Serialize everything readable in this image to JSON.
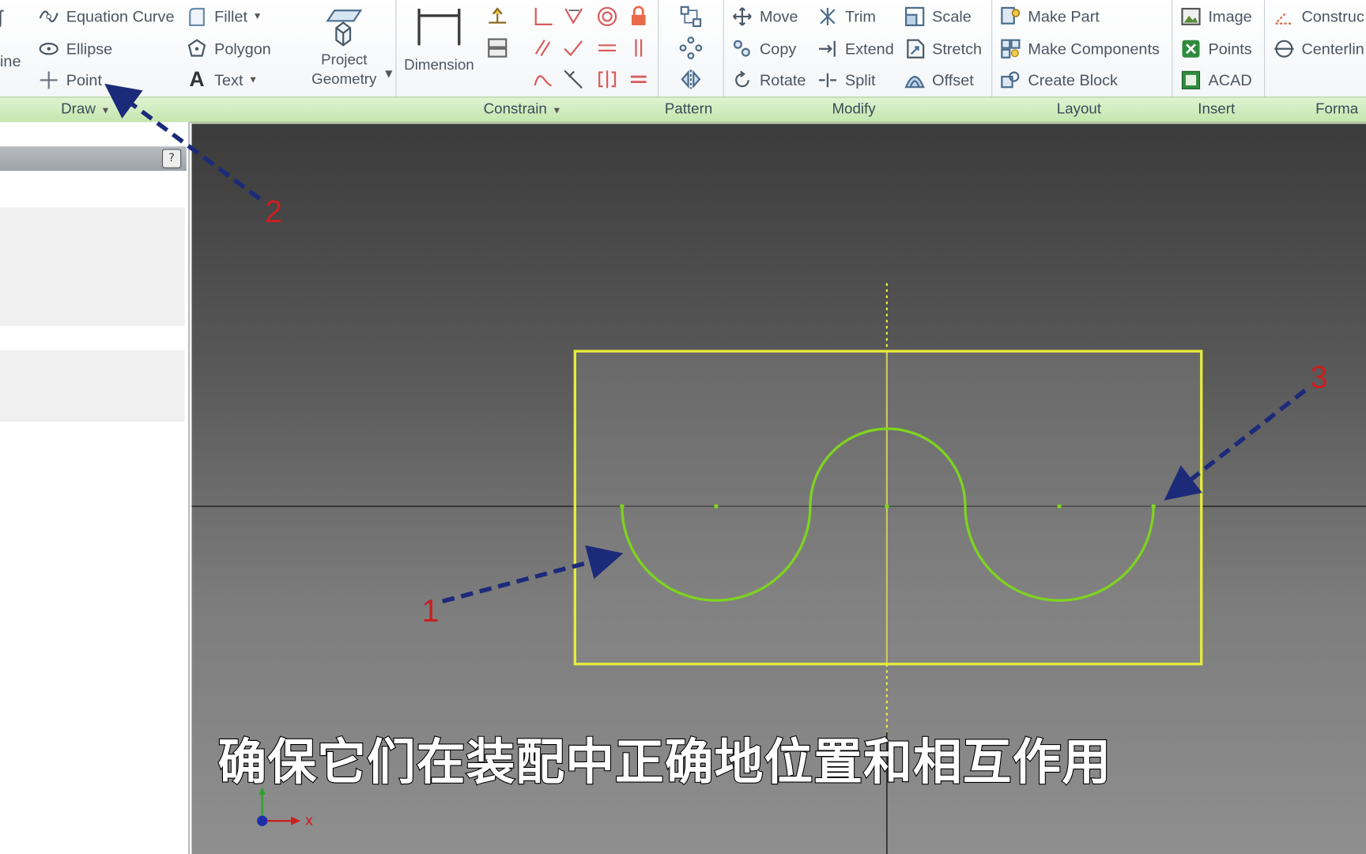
{
  "ribbon": {
    "draw": {
      "partial_line": "ine",
      "equation_curve": "Equation Curve",
      "ellipse": "Ellipse",
      "point": "Point",
      "fillet": "Fillet",
      "polygon": "Polygon",
      "text": "Text",
      "project_geometry_line1": "Project",
      "project_geometry_line2": "Geometry"
    },
    "constrain": {
      "dimension": "Dimension"
    },
    "modify": {
      "move": "Move",
      "copy": "Copy",
      "rotate": "Rotate",
      "trim": "Trim",
      "extend": "Extend",
      "split": "Split",
      "scale": "Scale",
      "stretch": "Stretch",
      "offset": "Offset"
    },
    "layout": {
      "make_part": "Make Part",
      "make_components": "Make Components",
      "create_block": "Create Block"
    },
    "insert": {
      "image": "Image",
      "points": "Points",
      "acad": "ACAD"
    },
    "format": {
      "construction": "Construc",
      "centerline": "Centerlin"
    },
    "panels": {
      "draw": "Draw",
      "constrain": "Constrain",
      "pattern": "Pattern",
      "modify": "Modify",
      "layout": "Layout",
      "insert": "Insert",
      "format": "Forma"
    }
  },
  "browser": {
    "help": "?"
  },
  "canvas": {
    "annotations": [
      "1",
      "2",
      "3"
    ],
    "caption": "确保它们在装配中正确地位置和相互作用",
    "axis_x": "x"
  },
  "colors": {
    "sketch_green": "#7ed321",
    "rect_yellow": "#e6ec3b",
    "arrow_blue": "#1c2a7a",
    "annotation_red": "#c8201f",
    "panel_green": "#c4e6ad"
  }
}
